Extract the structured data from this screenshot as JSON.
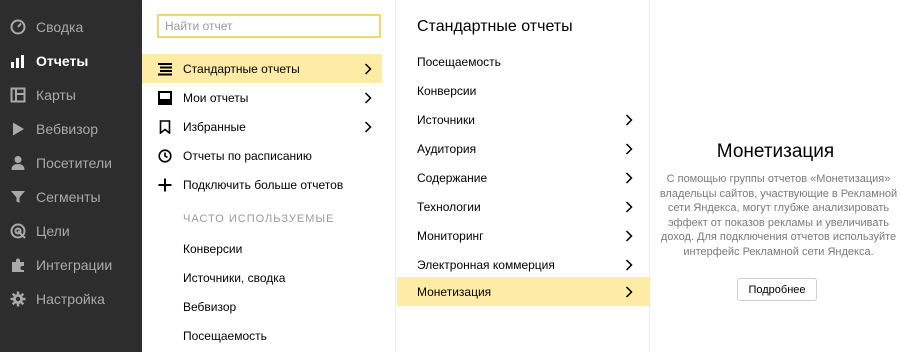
{
  "sidebar": {
    "items": [
      {
        "label": "Сводка",
        "icon": "dashboard-icon"
      },
      {
        "label": "Отчеты",
        "icon": "reports-icon",
        "active": true
      },
      {
        "label": "Карты",
        "icon": "maps-icon"
      },
      {
        "label": "Вебвизор",
        "icon": "play-icon"
      },
      {
        "label": "Посетители",
        "icon": "user-icon"
      },
      {
        "label": "Сегменты",
        "icon": "filter-icon"
      },
      {
        "label": "Цели",
        "icon": "target-icon"
      },
      {
        "label": "Интеграции",
        "icon": "puzzle-icon"
      },
      {
        "label": "Настройка",
        "icon": "gear-icon"
      }
    ]
  },
  "reports_menu": {
    "search_placeholder": "Найти отчет",
    "items": [
      {
        "label": "Стандартные отчеты",
        "icon": "list-icon",
        "active": true
      },
      {
        "label": "Мои отчеты",
        "icon": "inbox-icon"
      },
      {
        "label": "Избранные",
        "icon": "bookmark-icon"
      },
      {
        "label": "Отчеты по расписанию",
        "icon": "clock-icon"
      },
      {
        "label": "Подключить больше отчетов",
        "icon": "plus-icon"
      }
    ],
    "frequent_heading": "ЧАСТО ИСПОЛЬЗУЕМЫЕ",
    "frequent": [
      "Конверсии",
      "Источники, сводка",
      "Вебвизор",
      "Посещаемость"
    ]
  },
  "standard_reports": {
    "title": "Стандартные отчеты",
    "items": [
      {
        "label": "Посещаемость"
      },
      {
        "label": "Конверсии"
      },
      {
        "label": "Источники"
      },
      {
        "label": "Аудитория"
      },
      {
        "label": "Содержание"
      },
      {
        "label": "Технологии"
      },
      {
        "label": "Мониторинг"
      },
      {
        "label": "Электронная коммерция"
      },
      {
        "label": "Монетизация",
        "active": true
      }
    ]
  },
  "detail": {
    "title": "Монетизация",
    "description": "С помощью группы отчетов «Монетизация» владельцы сайтов, участвующие в Рекламной сети Яндекса, могут глубже анализировать эффект от показов рекламы и увеличивать доход. Для подключения отчетов используйте интерфейс Рекламной сети Яндекса.",
    "button_label": "Подробнее"
  },
  "colors": {
    "sidebar_bg": "#2d2d2d",
    "highlight": "#feeba6",
    "search_border": "#f0d96a"
  }
}
